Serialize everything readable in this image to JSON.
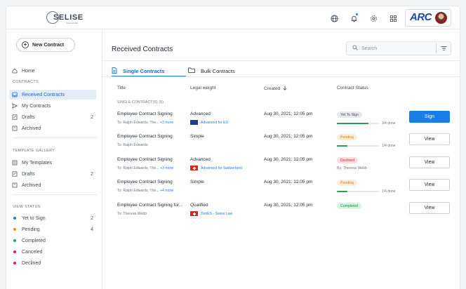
{
  "header": {
    "logo_text": "SELISE",
    "logo_sub": "SIGNATURE",
    "brand_text": "ARC",
    "icons": [
      "globe-icon",
      "bell-icon",
      "gear-icon",
      "grid-icon"
    ]
  },
  "sidebar": {
    "new_button": "New Contract",
    "home": "Home",
    "contracts_head": "CONTRACTS",
    "contracts": [
      {
        "label": "Received Contracts",
        "count": ""
      },
      {
        "label": "My Contracts",
        "count": ""
      },
      {
        "label": "Drafts",
        "count": "2"
      },
      {
        "label": "Archived",
        "count": ""
      }
    ],
    "templates_head": "TEMPLATE GALLERY",
    "templates": [
      {
        "label": "My Templates",
        "count": ""
      },
      {
        "label": "Drafts",
        "count": "2"
      },
      {
        "label": "Archived",
        "count": ""
      }
    ],
    "status_head": "VIEW STATUS",
    "statuses": [
      {
        "label": "Yet to Sign",
        "count": "2",
        "color": "#1a7ee8"
      },
      {
        "label": "Pending",
        "count": "4",
        "color": "#f08a1c"
      },
      {
        "label": "Completed",
        "count": "",
        "color": "#22a356"
      },
      {
        "label": "Canceled",
        "count": "",
        "color": "#e0243a"
      },
      {
        "label": "Declined",
        "count": "",
        "color": "#e0243a"
      }
    ]
  },
  "main": {
    "title": "Received Contracts",
    "search_placeholder": "Search",
    "tabs": [
      {
        "label": "Single Contracts"
      },
      {
        "label": "Bulk Contracts"
      }
    ],
    "columns": {
      "title": "Title",
      "legal": "Legal weight",
      "created": "Created",
      "status": "Contract Status"
    },
    "subheader": "SINGLE CONTRACT(S) (5)",
    "rows": [
      {
        "title": "Employee Contract Signing",
        "to": "To: Ralph Edwards, The... ",
        "more": "+3 more",
        "legal": "Advanced",
        "flag_label": "Advanced for EU",
        "created": "Aug 30, 2021; 12:05 pm",
        "status": "Yet To Sign",
        "status_bg": "#e6e8ec",
        "status_fg": "#4a5360",
        "progress": 0.75,
        "done": "3/4 done",
        "by": "",
        "action": "Sign"
      },
      {
        "title": "Employee Contract Signing",
        "to": "To: Ralph Edwards",
        "more": "",
        "legal": "Simple",
        "flag_label": "",
        "created": "Aug 30, 2021; 12:05 pm",
        "status": "Pending",
        "status_bg": "#fdecd6",
        "status_fg": "#d9791a",
        "progress": 0.25,
        "done": "1/4 done",
        "by": "",
        "action": "View"
      },
      {
        "title": "Employee Contract Signing",
        "to": "To: Ralph Edwards, The... ",
        "more": "+3 more",
        "legal": "Advanced",
        "flag_label": "Advanced for Switzerland",
        "created": "Aug 30, 2021; 12:05 pm",
        "status": "Declined",
        "status_bg": "#fbdde1",
        "status_fg": "#d32a3e",
        "progress": null,
        "done": "",
        "by": "By: Theresa Webb",
        "action": "View"
      },
      {
        "title": "Employee Contract Signing",
        "to": "To: Ralph Edwards, The... ",
        "more": "+4 more",
        "legal": "Simple",
        "flag_label": "",
        "created": "Aug 30, 2021; 12:05 pm",
        "status": "Pending",
        "status_bg": "#fdecd6",
        "status_fg": "#d9791a",
        "progress": 0.25,
        "done": "1/4 done",
        "by": "",
        "action": "View"
      },
      {
        "title": "Employee Contract Signing for...",
        "to": "To: Theresa Webb",
        "more": "",
        "legal": "Qualified",
        "flag_label": "ZertES - Swiss Law",
        "created": "Aug 30, 2021; 12:05 pm",
        "status": "Completed",
        "status_bg": "#d8f2e2",
        "status_fg": "#1f8d4c",
        "progress": null,
        "done": "",
        "by": "",
        "action": "View"
      }
    ]
  }
}
